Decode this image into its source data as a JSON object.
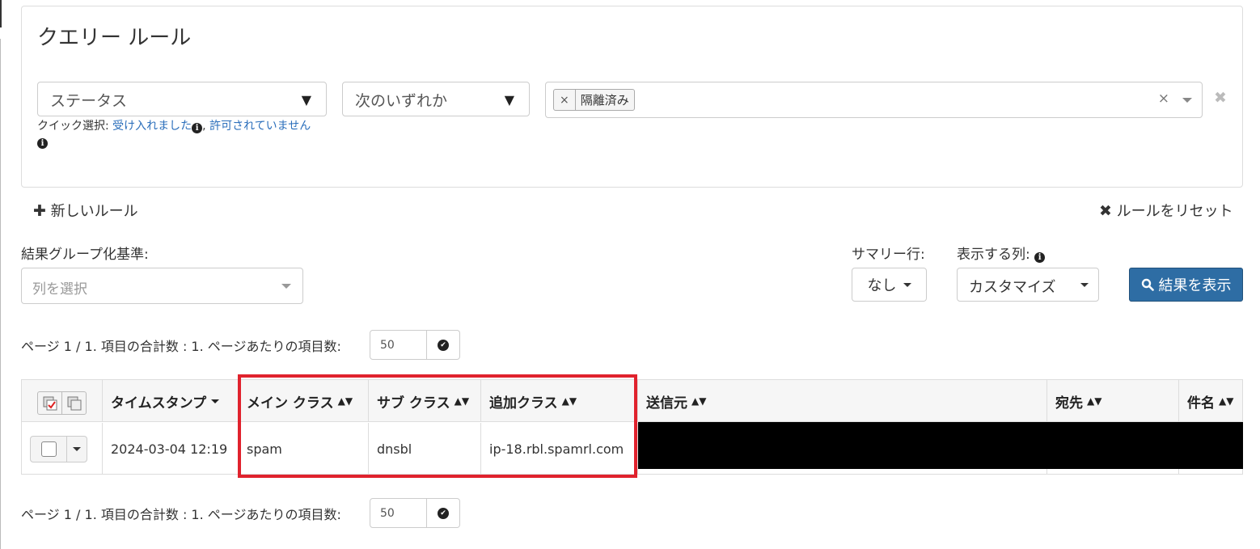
{
  "panel": {
    "title": "クエリー ルール",
    "field_select": "ステータス",
    "operator_select": "次のいずれか",
    "quick_select_label": "クイック選択: ",
    "quick_link_1": "受け入れました",
    "quick_sep": ", ",
    "quick_link_2": "許可されていません",
    "tag_remove": "×",
    "tag_value": "隔離済み",
    "clear_all": "×",
    "row_remove": "✖"
  },
  "actions": {
    "new_rule": "新しいルール",
    "reset_rules": "ルールをリセット"
  },
  "grouping": {
    "label": "結果グループ化基準:",
    "placeholder": "列を選択"
  },
  "summary": {
    "label": "サマリー行:",
    "value": "なし"
  },
  "columns_display": {
    "label": "表示する列:",
    "value": "カスタマイズ"
  },
  "show_results": "結果を表示",
  "pager_top": {
    "text": "ページ 1 / 1. 項目の合計数 : 1. ページあたりの項目数:",
    "per_page": "50"
  },
  "pager_bottom": {
    "text": "ページ 1 / 1. 項目の合計数 : 1. ページあたりの項目数:",
    "per_page": "50"
  },
  "table": {
    "headers": {
      "timestamp": "タイムスタンプ",
      "main_class": "メイン クラス",
      "sub_class": "サブ クラス",
      "extra_class": "追加クラス",
      "sender": "送信元",
      "recipient": "宛先",
      "subject": "件名"
    },
    "rows": [
      {
        "timestamp": "2024-03-04 12:19",
        "main_class": "spam",
        "sub_class": "dnsbl",
        "extra_class": "ip-18.rbl.spamrl.com"
      }
    ]
  },
  "colors": {
    "primary": "#2e6da4",
    "link": "#2a6ebb",
    "highlight": "#e0222d"
  }
}
